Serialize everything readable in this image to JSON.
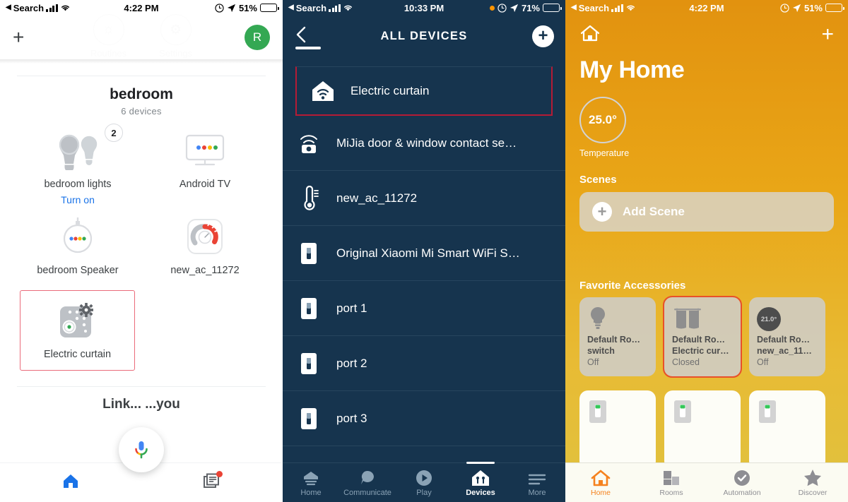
{
  "panels": {
    "google_home": {
      "status_bar": {
        "carrier": "Search",
        "time": "4:22 PM",
        "battery": "51%",
        "wifi_icon": "wifi-icon",
        "signal_icon": "cellular-signal-icon",
        "location_icon": "location-arrow-icon",
        "alarm_icon": "alarm-icon"
      },
      "ghost_tabs": [
        {
          "label": "Routines",
          "icon": "routines-icon"
        },
        {
          "label": "Settings",
          "icon": "gear-icon"
        }
      ],
      "topbar": {
        "add_label": "+",
        "avatar_initial": "R"
      },
      "room": {
        "title": "bedroom",
        "subtitle": "6 devices"
      },
      "devices": [
        {
          "name": "bedroom lights",
          "icon": "light-bulbs-icon",
          "badge": "2",
          "action": "Turn on"
        },
        {
          "name": "Android TV",
          "icon": "tv-icon"
        },
        {
          "name": "bedroom Speaker",
          "icon": "speaker-icon"
        },
        {
          "name": "new_ac_11272",
          "icon": "ac-gauge-icon"
        },
        {
          "name": "Electric curtain",
          "icon": "curtain-settings-icon",
          "selected": true
        }
      ],
      "cut_off_text": "Link...  ...you",
      "nav": [
        {
          "name": "home",
          "icon": "home-icon",
          "active": true
        },
        {
          "name": "feed",
          "icon": "feed-icon",
          "badge": true
        }
      ],
      "fab": {
        "icon": "google-assistant-mic-icon"
      },
      "colors": {
        "accent": "#1a73e8",
        "avatar": "#34a853",
        "highlight": "#ea6b7a",
        "badge_dot": "#ea4335"
      }
    },
    "alexa": {
      "status_bar": {
        "carrier": "Search",
        "time": "10:33 PM",
        "battery": "71%",
        "recording_dot": true
      },
      "header": {
        "title": "ALL DEVICES",
        "back_icon": "chevron-left-icon",
        "add_icon": "plus-circle-icon"
      },
      "devices": [
        {
          "label": "Electric curtain",
          "icon": "home-wifi-icon",
          "selected": true
        },
        {
          "label": "MiJia door & window contact se…",
          "icon": "contact-sensor-icon"
        },
        {
          "label": "new_ac_11272",
          "icon": "thermometer-icon"
        },
        {
          "label": "Original Xiaomi Mi Smart WiFi S…",
          "icon": "switch-icon"
        },
        {
          "label": "port 1",
          "icon": "switch-icon"
        },
        {
          "label": "port 2",
          "icon": "switch-icon"
        },
        {
          "label": "port 3",
          "icon": "switch-icon"
        }
      ],
      "tabs": [
        {
          "label": "Home",
          "icon": "home-icon",
          "active": false
        },
        {
          "label": "Communicate",
          "icon": "speech-bubble-icon",
          "active": false
        },
        {
          "label": "Play",
          "icon": "play-circle-icon",
          "active": false
        },
        {
          "label": "Devices",
          "icon": "devices-home-icon",
          "active": true
        },
        {
          "label": "More",
          "icon": "hamburger-menu-icon",
          "active": false
        }
      ],
      "colors": {
        "background": "#16344e",
        "highlight": "#b51b35",
        "divider": "#27455e",
        "inactive_tab": "#8aa2b5"
      }
    },
    "apple_home": {
      "status_bar": {
        "carrier": "Search",
        "time": "4:22 PM",
        "battery": "51%"
      },
      "header": {
        "home_icon": "house-icon",
        "add_label": "+"
      },
      "title": "My Home",
      "temperature": {
        "value": "25.0°",
        "label": "Temperature"
      },
      "scenes": {
        "section_title": "Scenes",
        "add_scene_label": "Add Scene",
        "add_icon": "plus-circle-icon"
      },
      "favorites": {
        "section_title": "Favorite Accessories",
        "items": [
          {
            "room": "Default Ro…",
            "name": "switch",
            "state": "Off",
            "icon": "light-bulb-icon",
            "selected": false
          },
          {
            "room": "Default Ro…",
            "name": "Electric cur…",
            "state": "Closed",
            "icon": "curtain-icon",
            "selected": true
          },
          {
            "room": "Default Ro…",
            "name": "new_ac_11…",
            "state": "Off",
            "icon": "thermostat-icon",
            "badge": "21.0°",
            "selected": false
          }
        ],
        "partial_row": [
          {
            "icon": "wall-switch-icon"
          },
          {
            "icon": "wall-switch-icon"
          },
          {
            "icon": "wall-switch-icon"
          }
        ]
      },
      "tabs": [
        {
          "label": "Home",
          "icon": "home-icon",
          "active": true
        },
        {
          "label": "Rooms",
          "icon": "rooms-icon",
          "active": false
        },
        {
          "label": "Automation",
          "icon": "clock-check-icon",
          "active": false
        },
        {
          "label": "Discover",
          "icon": "star-icon",
          "active": false
        }
      ],
      "colors": {
        "gradient_top": "#e2920f",
        "gradient_bottom": "#e0c23f",
        "accent": "#f5821f",
        "highlight": "#e8502a",
        "tile": "#cecece"
      }
    }
  }
}
